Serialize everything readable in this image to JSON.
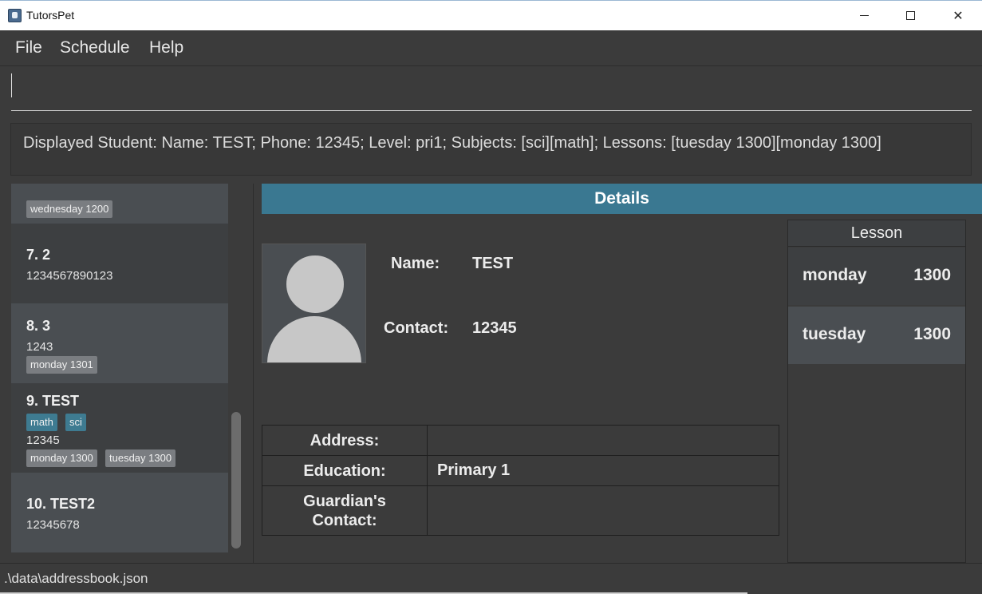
{
  "window": {
    "title": "TutorsPet",
    "min_glyph": "",
    "close_glyph": "✕"
  },
  "menu": [
    "File",
    "Schedule",
    "Help"
  ],
  "command": {
    "value": ""
  },
  "result": "Displayed Student: Name: TEST; Phone: 12345; Level: pri1; Subjects: [sci][math]; Lessons: [tuesday 1300][monday 1300]",
  "students": [
    {
      "title": "",
      "phone": "",
      "tags_lessons": [
        "wednesday 1200"
      ]
    },
    {
      "title": "7.  2",
      "phone": "1234567890123",
      "tags_lessons": []
    },
    {
      "title": "8.  3",
      "phone": "1243",
      "tags_lessons": [
        "monday 1301"
      ]
    },
    {
      "title": "9.  TEST",
      "phone": "12345",
      "tags_subjects": [
        "math",
        "sci"
      ],
      "tags_lessons": [
        "monday 1300",
        "tuesday 1300"
      ]
    },
    {
      "title": "10.  TEST2",
      "phone": "12345678",
      "tags_lessons": []
    }
  ],
  "details": {
    "header": "Details",
    "name_label": "Name:",
    "name_value": "TEST",
    "contact_label": "Contact:",
    "contact_value": "12345",
    "table": [
      {
        "key": "Address:",
        "value": ""
      },
      {
        "key": "Education:",
        "value": "Primary 1"
      },
      {
        "key": "Guardian's Contact:",
        "value": ""
      }
    ]
  },
  "lessons": {
    "title": "Lesson",
    "rows": [
      {
        "day": "monday",
        "time": "1300"
      },
      {
        "day": "tuesday",
        "time": "1300"
      }
    ]
  },
  "status": {
    "file_path": ".\\data\\addressbook.json"
  }
}
